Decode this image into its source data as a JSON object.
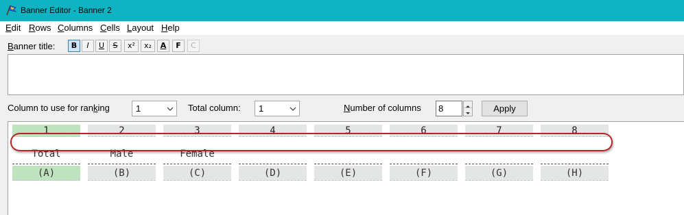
{
  "window": {
    "title": "Banner Editor - Banner 2"
  },
  "menu": [
    {
      "label": "Edit",
      "ul": "E",
      "rest": "dit"
    },
    {
      "label": "Rows",
      "ul": "R",
      "rest": "ows"
    },
    {
      "label": "Columns",
      "ul": "C",
      "rest": "olumns"
    },
    {
      "label": "Cells",
      "ul": "C",
      "rest": "ells"
    },
    {
      "label": "Layout",
      "ul": "L",
      "rest": "ayout"
    },
    {
      "label": "Help",
      "ul": "H",
      "rest": "elp"
    }
  ],
  "banner_title": {
    "label_ul": "B",
    "label_rest": "anner title:",
    "format_buttons": [
      {
        "label": "B",
        "name": "bold",
        "active": true
      },
      {
        "label": "I",
        "name": "italic",
        "active": false
      },
      {
        "label": "U",
        "name": "underline",
        "active": false
      },
      {
        "label": "S",
        "name": "strikethrough",
        "active": false
      },
      {
        "label": "x²",
        "name": "superscript",
        "active": false
      },
      {
        "label": "x₂",
        "name": "subscript",
        "active": false
      },
      {
        "label": "A",
        "name": "font-color",
        "active": false
      },
      {
        "label": "F",
        "name": "font",
        "active": false
      },
      {
        "label": "C",
        "name": "clear",
        "active": false,
        "disabled": true
      }
    ],
    "value": ""
  },
  "ranking": {
    "label_a": "Column to use for ran",
    "label_ul": "k",
    "label_b": "ing",
    "value": "1"
  },
  "total": {
    "label": "Total column:",
    "value": "1"
  },
  "num_columns": {
    "label_ul": "N",
    "label_rest": "umber of columns",
    "value": "8"
  },
  "apply_label": "Apply",
  "columns": [
    {
      "number": "1",
      "name": "Total",
      "letter": "(A)",
      "selected": true
    },
    {
      "number": "2",
      "name": "Male",
      "letter": "(B)",
      "selected": false
    },
    {
      "number": "3",
      "name": "Female",
      "letter": "(C)",
      "selected": false
    },
    {
      "number": "4",
      "name": "",
      "letter": "(D)",
      "selected": false
    },
    {
      "number": "5",
      "name": "",
      "letter": "(E)",
      "selected": false
    },
    {
      "number": "6",
      "name": "",
      "letter": "(F)",
      "selected": false
    },
    {
      "number": "7",
      "name": "",
      "letter": "(G)",
      "selected": false
    },
    {
      "number": "8",
      "name": "",
      "letter": "(H)",
      "selected": false
    }
  ],
  "colors": {
    "titlebar": "#0fb3c2",
    "highlight": "#b3262a",
    "selected_cell": "#bfe3bf"
  }
}
